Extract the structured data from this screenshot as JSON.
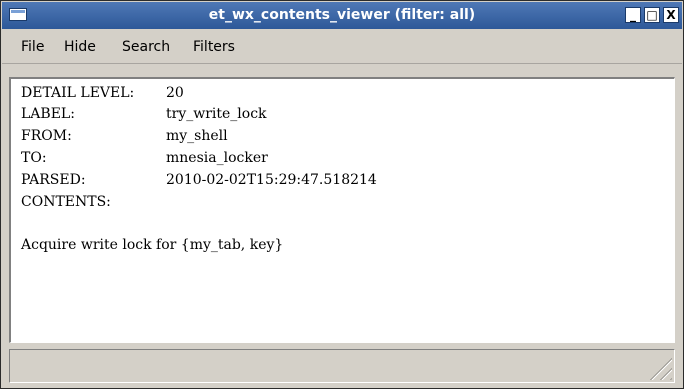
{
  "window": {
    "title": "et_wx_contents_viewer (filter: all)",
    "minimize_glyph": "_",
    "maximize_glyph": "□",
    "close_glyph": "X"
  },
  "menu": {
    "items": [
      {
        "label": "File"
      },
      {
        "label": "Hide"
      },
      {
        "label": "Search"
      },
      {
        "label": "Filters"
      }
    ]
  },
  "details": {
    "detail_level_label": "DETAIL LEVEL:",
    "detail_level_value": "20",
    "label_label": "LABEL:",
    "label_value": "try_write_lock",
    "from_label": "FROM:",
    "from_value": "my_shell",
    "to_label": "TO:",
    "to_value": "mnesia_locker",
    "parsed_label": "PARSED:",
    "parsed_value": "2010-02-02T15:29:47.518214",
    "contents_label": "CONTENTS:",
    "message": "Acquire write lock for {my_tab, key}"
  },
  "colors": {
    "titlebar": "#3a64a8",
    "window_bg": "#d4d0c8",
    "content_bg": "#ffffff"
  }
}
